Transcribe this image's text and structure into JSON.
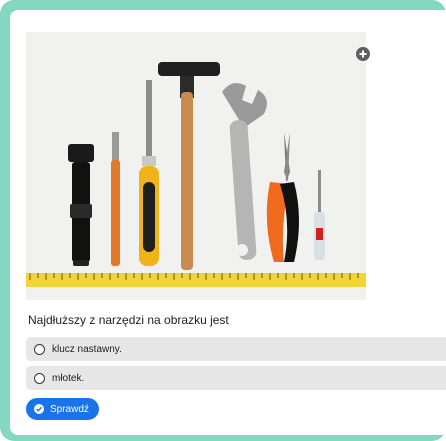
{
  "quiz": {
    "question": "Najdłuższy z narzędzi na obrazku jest",
    "options": [
      {
        "label": "klucz nastawny."
      },
      {
        "label": "młotek."
      }
    ],
    "check_label": "Sprawdź"
  },
  "image": {
    "subject": "tools on ruler",
    "icons": {
      "expand": "plus-circle-icon",
      "check": "check-circle-icon"
    }
  },
  "colors": {
    "frame": "#84d8bf",
    "button": "#1a73e8",
    "option_bg": "#e7e7e7"
  }
}
